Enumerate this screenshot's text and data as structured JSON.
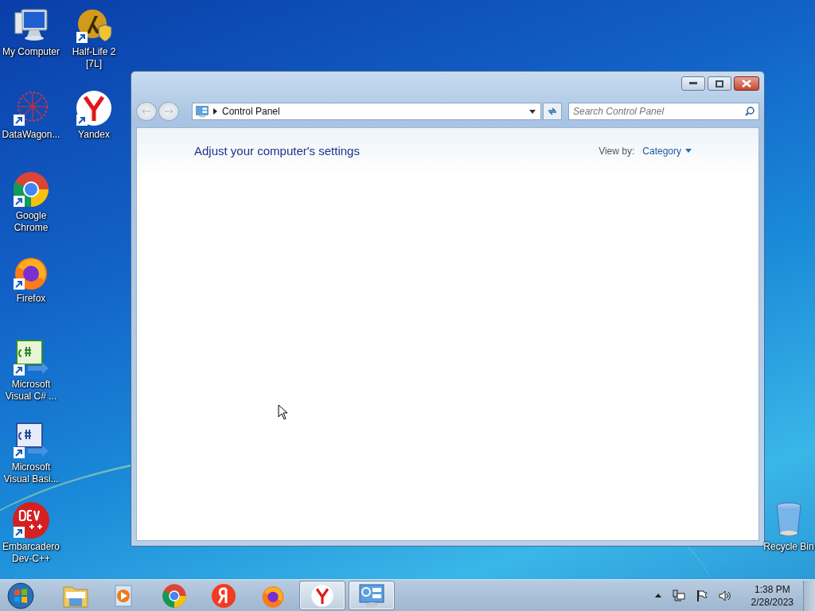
{
  "desktop_icons": [
    {
      "label": "My Computer",
      "kind": "computer"
    },
    {
      "label": "Half-Life 2 [7L]",
      "kind": "halflife"
    },
    {
      "label": "DataWagon...",
      "kind": "datawagon"
    },
    {
      "label": "Yandex",
      "kind": "yandex"
    },
    {
      "label": "Google Chrome",
      "kind": "chrome"
    },
    {
      "label": "Firefox",
      "kind": "firefox"
    },
    {
      "label": "Microsoft Visual C# ...",
      "kind": "csharp"
    },
    {
      "label": "Microsoft Visual Basi...",
      "kind": "vb"
    },
    {
      "label": "Embarcadero Dev-C++",
      "kind": "devcpp"
    },
    {
      "label": "Recycle Bin",
      "kind": "recycle"
    }
  ],
  "window": {
    "address": "Control Panel",
    "search": {
      "placeholder": "Search Control Panel"
    },
    "heading": "Adjust your computer's settings",
    "view_by_label": "View by:",
    "view_by_value": "Category"
  },
  "taskbar": {
    "items": [
      {
        "kind": "explorer",
        "running": false
      },
      {
        "kind": "media",
        "running": false
      },
      {
        "kind": "chrome",
        "running": false
      },
      {
        "kind": "yandex-ru",
        "running": false
      },
      {
        "kind": "firefox",
        "running": false
      },
      {
        "kind": "yandex",
        "running": true
      },
      {
        "kind": "control-panel",
        "running": true
      }
    ],
    "time": "1:38 PM",
    "date": "2/28/2023"
  }
}
